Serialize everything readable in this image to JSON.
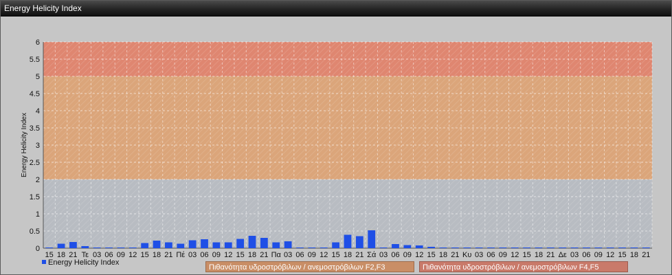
{
  "window": {
    "title": "Energy Helicity Index"
  },
  "legend": {
    "series_label": "Energy Helicity Index",
    "band_f2f3": "Πιθανότητα υδροστρόβιλων / ανεμοστρόβιλων F2,F3",
    "band_f4f5": "Πιθανότητα υδροστρόβιλων / ανεμοστρόβιλων F4,F5"
  },
  "colors": {
    "bar": "#1f4fe6",
    "band_low": "#b8bcc2",
    "band_f2f3": "#dba57a",
    "band_f4f5": "#df8670"
  },
  "chart_data": {
    "type": "bar",
    "title": "",
    "xlabel": "",
    "ylabel": "Energy Helicity Index",
    "ylim": [
      0,
      6
    ],
    "yticks": [
      "0",
      "0.5",
      "1",
      "1.5",
      "2",
      "2.5",
      "3",
      "3.5",
      "4",
      "4.5",
      "5",
      "5.5",
      "6"
    ],
    "grid": true,
    "bands": [
      {
        "from": 0,
        "to": 2,
        "label": ""
      },
      {
        "from": 2,
        "to": 5,
        "label": "Πιθανότητα υδροστρόβιλων / ανεμοστρόβιλων F2,F3"
      },
      {
        "from": 5,
        "to": 6,
        "label": "Πιθανότητα υδροστρόβιλων / ανεμοστρόβιλων F4,F5"
      }
    ],
    "categories": [
      "15",
      "18",
      "21",
      "Τε",
      "03",
      "06",
      "09",
      "12",
      "15",
      "18",
      "21",
      "Πέ",
      "03",
      "06",
      "09",
      "12",
      "15",
      "18",
      "21",
      "Πα",
      "03",
      "06",
      "09",
      "12",
      "15",
      "18",
      "21",
      "Σά",
      "03",
      "06",
      "09",
      "12",
      "15",
      "18",
      "21",
      "Κυ",
      "03",
      "06",
      "09",
      "12",
      "15",
      "18",
      "21",
      "Δε",
      "03",
      "06",
      "09",
      "12",
      "15",
      "18",
      "21"
    ],
    "series": [
      {
        "name": "Energy Helicity Index",
        "values": [
          0.01,
          0.13,
          0.18,
          0.06,
          0.02,
          0.02,
          0.02,
          0.01,
          0.15,
          0.22,
          0.17,
          0.13,
          0.23,
          0.26,
          0.17,
          0.17,
          0.27,
          0.36,
          0.3,
          0.17,
          0.2,
          0.02,
          0.01,
          0.01,
          0.17,
          0.39,
          0.35,
          0.52,
          0.02,
          0.12,
          0.09,
          0.08,
          0.04,
          0.01,
          0.01,
          0.01,
          0.01,
          0.01,
          0.01,
          0.01,
          0.01,
          0.01,
          0.01,
          0.01,
          0.01,
          0.01,
          0.01,
          0.01,
          0.01,
          0.01,
          0.01
        ]
      }
    ]
  }
}
